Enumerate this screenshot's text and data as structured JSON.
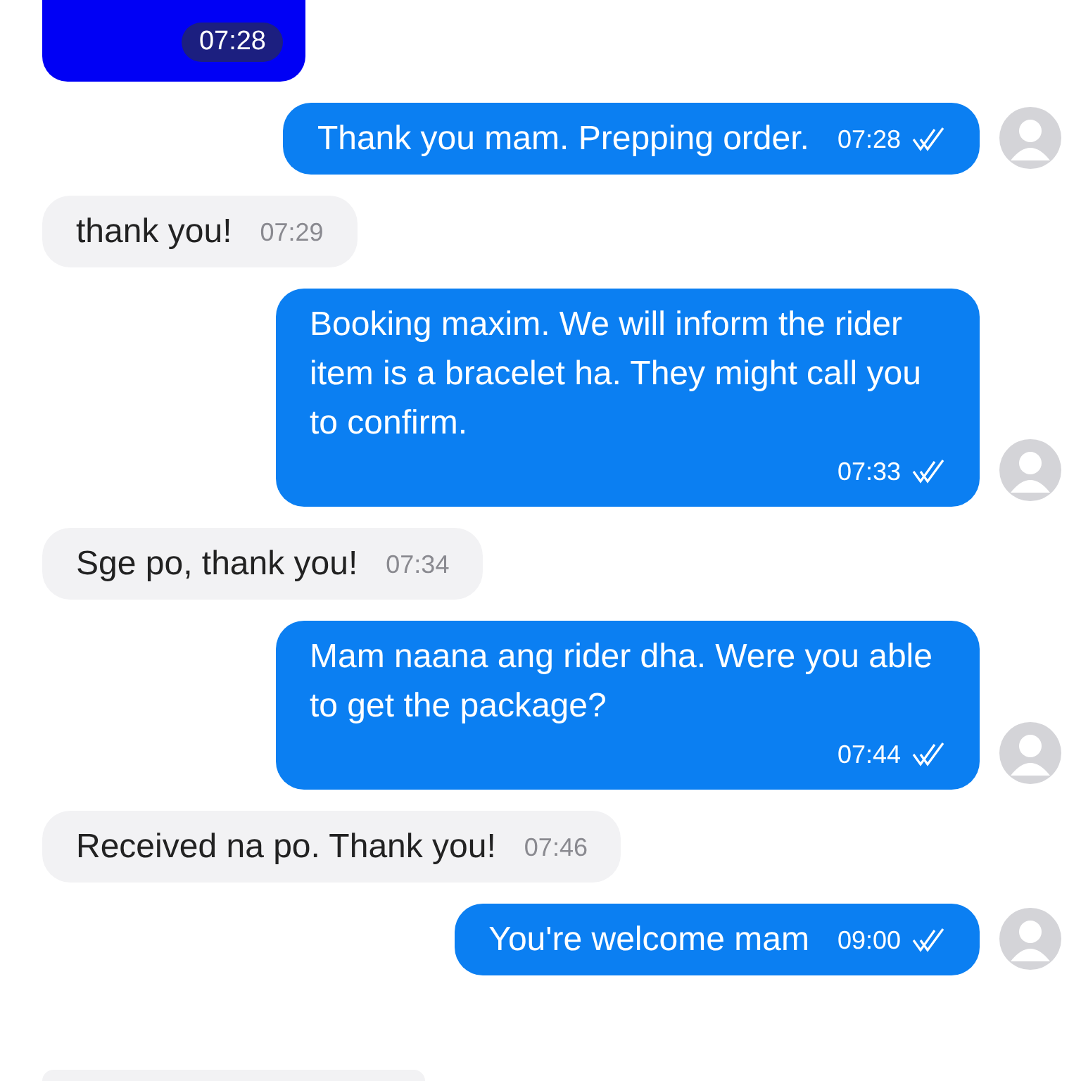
{
  "messages": [
    {
      "kind": "media",
      "outgoing": false,
      "time": "07:28"
    },
    {
      "kind": "text",
      "outgoing": true,
      "text": "Thank you mam. Prepping order.",
      "time": "07:28",
      "read": true
    },
    {
      "kind": "text",
      "outgoing": false,
      "text": "thank you!",
      "time": "07:29"
    },
    {
      "kind": "text",
      "outgoing": true,
      "text": "Booking maxim. We will inform the rider item is a bracelet ha. They might call you to confirm.",
      "time": "07:33",
      "read": true
    },
    {
      "kind": "text",
      "outgoing": false,
      "text": "Sge po, thank you!",
      "time": "07:34"
    },
    {
      "kind": "text",
      "outgoing": true,
      "text": "Mam naana ang rider dha. Were you able to get the package?",
      "time": "07:44",
      "read": true
    },
    {
      "kind": "text",
      "outgoing": false,
      "text": "Received na po. Thank you!",
      "time": "07:46"
    },
    {
      "kind": "text",
      "outgoing": true,
      "text": "You're welcome mam",
      "time": "09:00",
      "read": true
    },
    {
      "kind": "stub",
      "outgoing": false
    }
  ]
}
